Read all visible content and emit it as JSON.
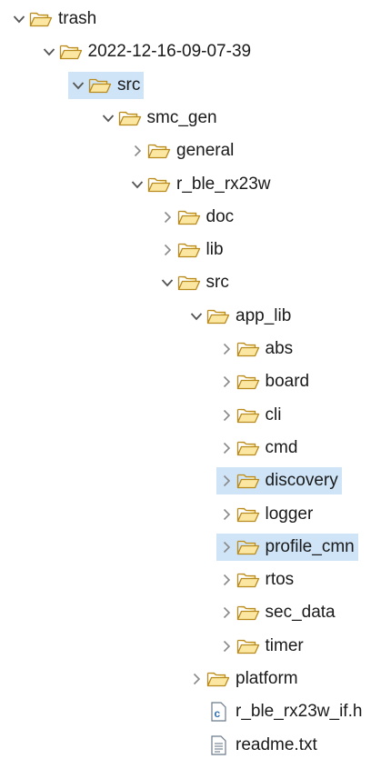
{
  "tree": {
    "items": [
      {
        "label": "trash",
        "level": 0,
        "state": "expanded",
        "type": "folder",
        "selected": false
      },
      {
        "label": "2022-12-16-09-07-39",
        "level": 1,
        "state": "expanded",
        "type": "folder",
        "selected": false
      },
      {
        "label": "src",
        "level": 2,
        "state": "expanded",
        "type": "folder",
        "selected": true
      },
      {
        "label": "smc_gen",
        "level": 3,
        "state": "expanded",
        "type": "folder",
        "selected": false
      },
      {
        "label": "general",
        "level": 4,
        "state": "collapsed",
        "type": "folder",
        "selected": false
      },
      {
        "label": "r_ble_rx23w",
        "level": 4,
        "state": "expanded",
        "type": "folder",
        "selected": false
      },
      {
        "label": "doc",
        "level": 5,
        "state": "collapsed",
        "type": "folder",
        "selected": false
      },
      {
        "label": "lib",
        "level": 5,
        "state": "collapsed",
        "type": "folder",
        "selected": false
      },
      {
        "label": "src",
        "level": 5,
        "state": "expanded",
        "type": "folder",
        "selected": false
      },
      {
        "label": "app_lib",
        "level": 6,
        "state": "expanded",
        "type": "folder",
        "selected": false
      },
      {
        "label": "abs",
        "level": 7,
        "state": "collapsed",
        "type": "folder",
        "selected": false
      },
      {
        "label": "board",
        "level": 7,
        "state": "collapsed",
        "type": "folder",
        "selected": false
      },
      {
        "label": "cli",
        "level": 7,
        "state": "collapsed",
        "type": "folder",
        "selected": false
      },
      {
        "label": "cmd",
        "level": 7,
        "state": "collapsed",
        "type": "folder",
        "selected": false
      },
      {
        "label": "discovery",
        "level": 7,
        "state": "collapsed",
        "type": "folder",
        "selected": true
      },
      {
        "label": "logger",
        "level": 7,
        "state": "collapsed",
        "type": "folder",
        "selected": false
      },
      {
        "label": "profile_cmn",
        "level": 7,
        "state": "collapsed",
        "type": "folder",
        "selected": true
      },
      {
        "label": "rtos",
        "level": 7,
        "state": "collapsed",
        "type": "folder",
        "selected": false
      },
      {
        "label": "sec_data",
        "level": 7,
        "state": "collapsed",
        "type": "folder",
        "selected": false
      },
      {
        "label": "timer",
        "level": 7,
        "state": "collapsed",
        "type": "folder",
        "selected": false
      },
      {
        "label": "platform",
        "level": 6,
        "state": "collapsed",
        "type": "folder",
        "selected": false
      },
      {
        "label": "r_ble_rx23w_if.h",
        "level": 6,
        "state": "leaf",
        "type": "c-header-file",
        "selected": false
      },
      {
        "label": "readme.txt",
        "level": 6,
        "state": "leaf",
        "type": "text-file",
        "selected": false
      }
    ]
  },
  "colors": {
    "selection": "#cfe4f7",
    "folder_fill": "#fbe7a1",
    "folder_stroke": "#b98a1e",
    "chevron": "#555555",
    "text": "#1a1a1a",
    "c_file_accent": "#2f6fb3"
  }
}
